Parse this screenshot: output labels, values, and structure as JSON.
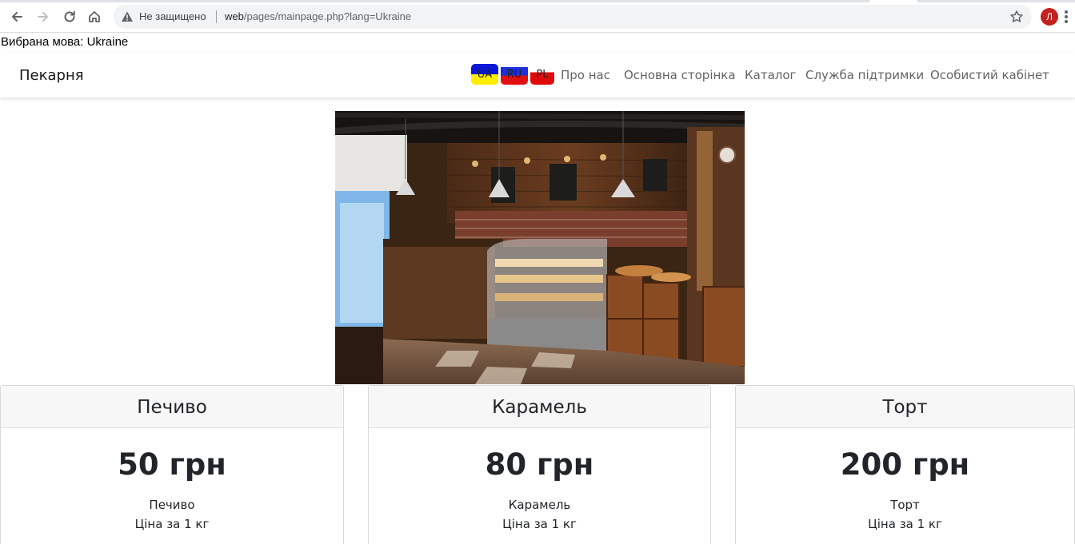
{
  "browser": {
    "security_label": "Не защищено",
    "url_host": "web",
    "url_path": "/pages/mainpage.php?lang=Ukraine",
    "avatar_letter": "Л"
  },
  "language_line": "Вибрана мова: Ukraine",
  "navbar": {
    "brand": "Пекарня",
    "flags": [
      {
        "label": "UA"
      },
      {
        "label": "RU"
      },
      {
        "label": "PL"
      }
    ],
    "links": [
      "Про нас",
      "Основна сторінка",
      "Каталог",
      "Служба підтримки",
      "Особистий кабінет"
    ]
  },
  "products": [
    {
      "header": "Печиво",
      "price": "50 грн",
      "name": "Печиво",
      "desc": "Ціна за 1 кг"
    },
    {
      "header": "Карамель",
      "price": "80 грн",
      "name": "Карамель",
      "desc": "Ціна за 1 кг"
    },
    {
      "header": "Торт",
      "price": "200 грн",
      "name": "Торт",
      "desc": "Ціна за 1 кг"
    }
  ]
}
